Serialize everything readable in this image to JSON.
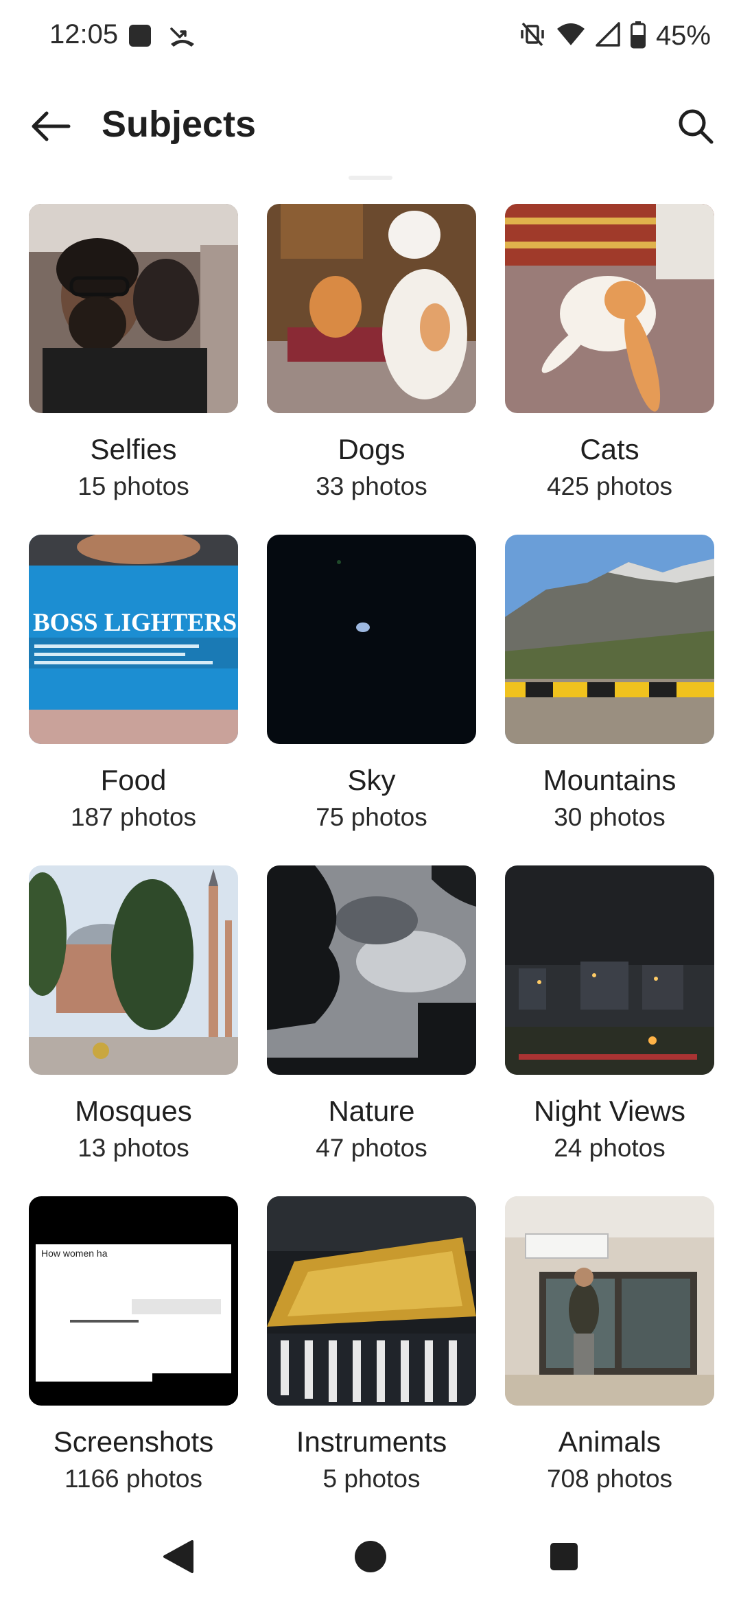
{
  "status_bar": {
    "time": "12:05",
    "battery": "45%",
    "icons": [
      "notification-square-icon",
      "missed-call-icon",
      "vibrate-off-icon",
      "wifi-icon",
      "signal-icon",
      "battery-icon"
    ]
  },
  "app_bar": {
    "title": "Subjects",
    "back_icon": "arrow-left-icon",
    "search_icon": "search-icon"
  },
  "subjects": [
    {
      "label": "Selfies",
      "count": "15 photos"
    },
    {
      "label": "Dogs",
      "count": "33 photos"
    },
    {
      "label": "Cats",
      "count": "425 photos"
    },
    {
      "label": "Food",
      "count": "187 photos"
    },
    {
      "label": "Sky",
      "count": "75 photos"
    },
    {
      "label": "Mountains",
      "count": "30 photos"
    },
    {
      "label": "Mosques",
      "count": "13 photos"
    },
    {
      "label": "Nature",
      "count": "47 photos"
    },
    {
      "label": "Night Views",
      "count": "24 photos"
    },
    {
      "label": "Screenshots",
      "count": "1166 photos"
    },
    {
      "label": "Instruments",
      "count": "5 photos"
    },
    {
      "label": "Animals",
      "count": "708 photos"
    }
  ],
  "thumbnail_text": {
    "food_banner": "BOSS LIGHTERS",
    "screenshot_line": "How women ha"
  },
  "nav_bar": {
    "icons": [
      "back-triangle-icon",
      "home-circle-icon",
      "recents-square-icon"
    ]
  }
}
